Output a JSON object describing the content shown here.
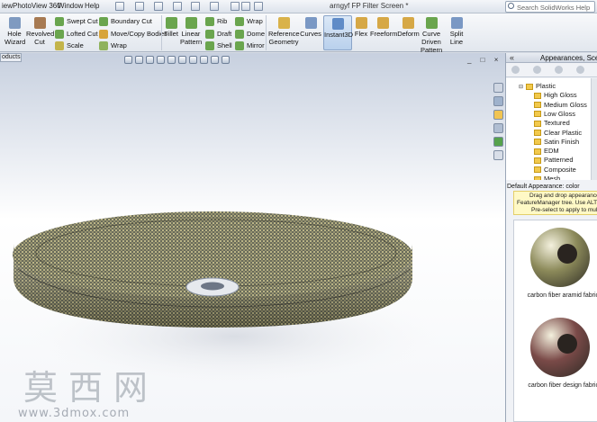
{
  "menubar": {
    "items": [
      "iew",
      "PhotoView 360",
      "Window",
      "Help"
    ],
    "title": "arngyf FP Filter Screen *",
    "search_placeholder": "Search SolidWorks Help"
  },
  "ribbon": {
    "hole_wizard": "Hole\nWizard",
    "revolved_cut": "Revolved\nCut",
    "swept_cut": "Swept Cut",
    "lofted_cut": "Lofted Cut",
    "scale": "Scale",
    "boundary_cut": "Boundary Cut",
    "move_copy_bodies": "Move/Copy Bodies",
    "wrap_small": "Wrap",
    "fillet": "Fillet",
    "linear_pattern": "Linear\nPattern",
    "rib": "Rib",
    "draft": "Draft",
    "shell": "Shell",
    "wrap": "Wrap",
    "dome": "Dome",
    "mirror": "Mirror",
    "reference_geometry": "Reference\nGeometry",
    "curves": "Curves",
    "instant3d": "Instant3D",
    "flex": "Flex",
    "freeform": "Freeform",
    "deform": "Deform",
    "curve_driven_pattern": "Curve\nDriven\nPattern",
    "split_line": "Split Line"
  },
  "left_tab": "oducts",
  "task_pane": {
    "title": "Appearances, Scenes",
    "tree": [
      {
        "label": "Plastic",
        "level": 0,
        "expanded": true
      },
      {
        "label": "High Gloss",
        "level": 1
      },
      {
        "label": "Medium Gloss",
        "level": 1
      },
      {
        "label": "Low Gloss",
        "level": 1
      },
      {
        "label": "Textured",
        "level": 1
      },
      {
        "label": "Clear Plastic",
        "level": 1
      },
      {
        "label": "Satin Finish",
        "level": 1
      },
      {
        "label": "EDM",
        "level": 1
      },
      {
        "label": "Patterned",
        "level": 1
      },
      {
        "label": "Composite",
        "level": 1
      },
      {
        "label": "Mesh",
        "level": 1
      }
    ],
    "default_appearance": "Default Appearance: color",
    "hint_lines": [
      "Drag and drop appearances",
      "FeatureManager tree.  Use ALT-d",
      "Pre-select to apply to multi"
    ],
    "swatches": [
      {
        "label": "carbon fiber aramid fabric",
        "color": "#8c8a5a"
      },
      {
        "label": "carbon fiber design fabric",
        "color": "#7a4a48"
      }
    ]
  },
  "watermark": {
    "chinese": "莫西网",
    "url": "www.3dmox.com"
  },
  "colors": {
    "accent": "#4a78b8",
    "mesh_gold": "#a8a070",
    "mesh_dark": "#3f4136"
  }
}
